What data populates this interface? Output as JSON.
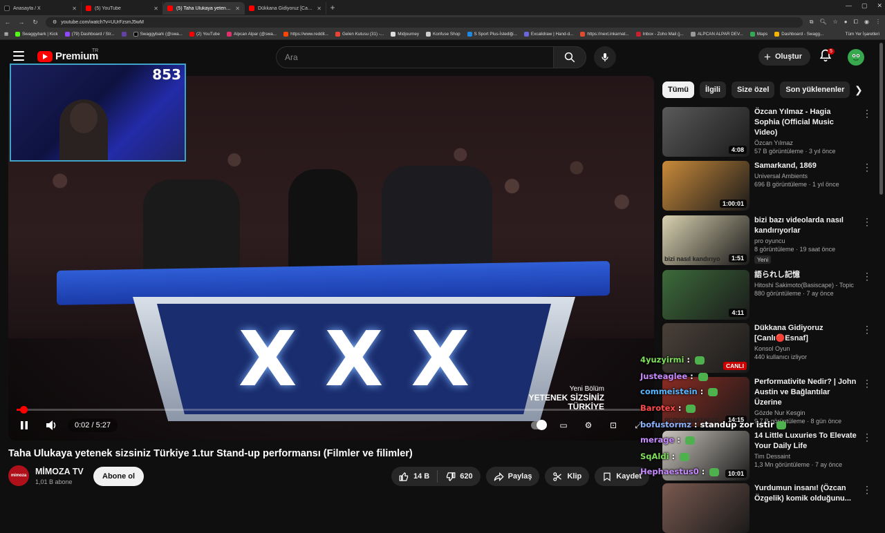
{
  "browser": {
    "tabs": [
      {
        "title": "Anasayfa / X",
        "color": "#111111"
      },
      {
        "title": "(5) YouTube",
        "color": "#ff0000"
      },
      {
        "title": "(5) Taha Ulukaya yetenek si...",
        "color": "#ff0000"
      },
      {
        "title": "Dükkana Gidiyoruz [Canlı 🔴 Es...",
        "color": "#ff0000"
      }
    ],
    "url": "youtube.com/watch?v=UUrFzsmJ5wM",
    "bookmarks": [
      "Swaggybark | Kick",
      "(79) Dashboard / Str...",
      "",
      "Swaggybark (@swa...",
      "(2) YouTube",
      "Alpcan Alpar (@swa...",
      "https://www.reddit...",
      "Gelen Kutusu (31) -...",
      "Midjourney",
      "Konfuse Shop",
      "S Sport Plus-İstediği...",
      "Excalidraw | Hand-d...",
      "https://next.inkarnat...",
      "Inbox - Zoho Mail (j...",
      "ALPCAN ALPAR DEV...",
      "Maps",
      "Dashboard - Swagg..."
    ],
    "bookmarks_right": "Tüm Yer İşaretleri"
  },
  "header": {
    "logo_text": "Premium",
    "logo_country": "TR",
    "search_placeholder": "Ara",
    "create_label": "Oluştur",
    "notifications": "5"
  },
  "player": {
    "time": "0:02 / 5:27",
    "progress": 0.006,
    "cam_counter": "853",
    "show_logo_line1": "Yeni Bölüm",
    "show_logo_line2": "YETENEK SİZSİNİZ",
    "show_logo_line3": "TÜRKİYE",
    "desk_letters": [
      "X",
      "X",
      "X"
    ]
  },
  "video": {
    "title": "Taha Ulukaya yetenek sizsiniz Türkiye 1.tur Stand-up performansı (Filmler ve filimler)",
    "channel": "MİMOZA TV",
    "channel_avatar_text": "mimoza",
    "subscribers": "1,01 B abone",
    "subscribe_label": "Abone ol",
    "likes": "14 B",
    "dislikes": "620",
    "share_label": "Paylaş",
    "clip_label": "Klip",
    "save_label": "Kaydet"
  },
  "chips": [
    "Tümü",
    "İlgili",
    "Size özel",
    "Son yüklenenler"
  ],
  "recommendations": [
    {
      "title": "Özcan Yılmaz - Hagia Sophia (Official Music Video)",
      "channel": "Özcan Yılmaz",
      "meta": "57 B görüntüleme · 3 yıl önce",
      "duration": "4:08",
      "thumb_color": "#5a5a5a"
    },
    {
      "title": "Samarkand, 1869",
      "channel": "Universal Ambients",
      "meta": "696 B görüntüleme · 1 yıl önce",
      "duration": "1:00:01",
      "thumb_color": "#c98a3a"
    },
    {
      "title": "bizi bazı videolarda nasıl kandırıyorlar",
      "channel": "pro oyuncu",
      "meta": "8 görüntüleme · 19 saat önce",
      "duration": "1:51",
      "badge": "Yeni",
      "thumb_color": "#d9d1b0",
      "thumb_text": "bizi nasıl kandırıyo"
    },
    {
      "title": "語られし記憶",
      "channel": "Hitoshi Sakimoto(Basiscape) - Topic",
      "meta": "880 görüntüleme · 7 ay önce",
      "duration": "4:11",
      "thumb_color": "#3c6b3a"
    },
    {
      "title": "Dükkana Gidiyoruz [Canlı🔴Esnaf]",
      "channel": "Konsol Oyun",
      "meta": "440 kullanıcı izliyor",
      "live": "CANLI",
      "thumb_color": "#4a4038"
    },
    {
      "title": "Performativite Nedir? | John Austin ve Bağlantılar Üzerine",
      "channel": "Gözde Nur Kesgin",
      "meta": "9,7 B görüntüleme · 8 gün önce",
      "duration": "14:15",
      "thumb_color": "#8a2b22",
      "thumb_text": "PERFORMATIVITE"
    },
    {
      "title": "14 Little Luxuries To Elevate Your Daily Life",
      "channel": "Tim Dessaint",
      "meta": "1,3 Mn görüntüleme · 7 ay önce",
      "duration": "10:01",
      "thumb_color": "#c9c4bc"
    },
    {
      "title": "Yurdumun insanı! (Özcan Özgelik) komik olduğunu...",
      "channel": "",
      "meta": "",
      "duration": "",
      "thumb_color": "#7a5a50"
    }
  ],
  "chat": [
    {
      "user": "4yuzyirmi",
      "msg": "",
      "color": "#7ee05a"
    },
    {
      "user": "Justeaglee",
      "msg": "",
      "color": "#c88bff"
    },
    {
      "user": "commeistein",
      "msg": "",
      "color": "#5ab8ff"
    },
    {
      "user": "Barotex",
      "msg": "",
      "color": "#ff4a4a"
    },
    {
      "user": "bofustormz",
      "msg": "standup zor istir",
      "color": "#8ab4ff"
    },
    {
      "user": "merage",
      "msg": "",
      "color": "#c88bff"
    },
    {
      "user": "SqAldi",
      "msg": "",
      "color": "#7ee05a"
    },
    {
      "user": "Hephaestus0",
      "msg": "",
      "color": "#c88bff"
    }
  ]
}
